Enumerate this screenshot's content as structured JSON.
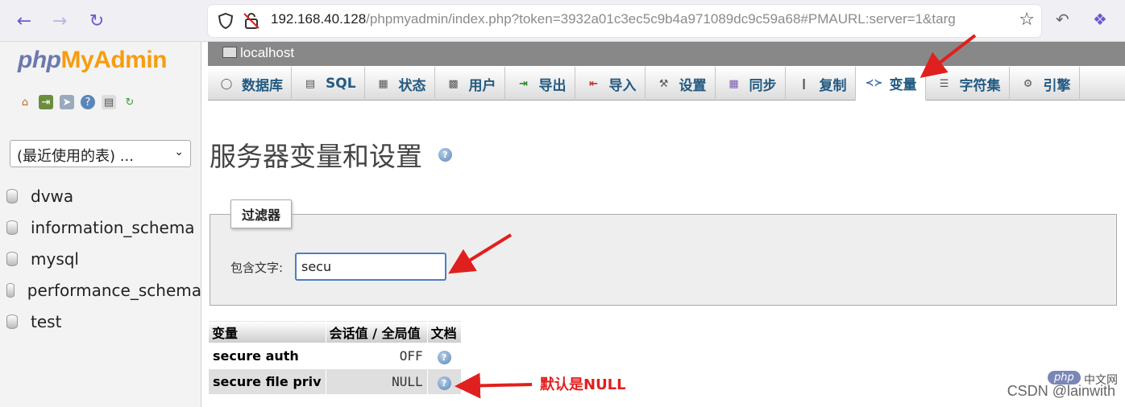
{
  "browser": {
    "url_host": "192.168.40.128",
    "url_rest": "/phpmyadmin/index.php?token=3932a01c3ec5c9b4a971089dc9c59a68#PMAURL:server=1&targ"
  },
  "left": {
    "logo_php": "php",
    "logo_myadmin": "MyAdmin",
    "table_select": "(最近使用的表) ...",
    "databases": [
      "dvwa",
      "information_schema",
      "mysql",
      "performance_schema",
      "test"
    ]
  },
  "server": {
    "label": "localhost"
  },
  "tabs": [
    {
      "label": "数据库",
      "icon": "database-icon"
    },
    {
      "label": "SQL",
      "icon": "sql-icon"
    },
    {
      "label": "状态",
      "icon": "status-icon"
    },
    {
      "label": "用户",
      "icon": "users-icon"
    },
    {
      "label": "导出",
      "icon": "export-icon"
    },
    {
      "label": "导入",
      "icon": "import-icon"
    },
    {
      "label": "设置",
      "icon": "settings-icon"
    },
    {
      "label": "同步",
      "icon": "sync-icon"
    },
    {
      "label": "复制",
      "icon": "replication-icon"
    },
    {
      "label": "变量",
      "icon": "variables-icon",
      "active": true
    },
    {
      "label": "字符集",
      "icon": "charset-icon"
    },
    {
      "label": "引擎",
      "icon": "engines-icon"
    }
  ],
  "page": {
    "title": "服务器变量和设置"
  },
  "filter": {
    "legend": "过滤器",
    "label": "包含文字:",
    "value": "secu"
  },
  "table": {
    "headers": [
      "变量",
      "会话值 / 全局值",
      "文档"
    ],
    "rows": [
      {
        "name": "secure auth",
        "value": "OFF"
      },
      {
        "name": "secure file priv",
        "value": "NULL"
      }
    ]
  },
  "annotation": {
    "note": "默认是NULL",
    "color": "#e0201e"
  },
  "watermark": {
    "text": "CSDN @lainwith",
    "badge": "php",
    "badge_suffix": "中文网"
  }
}
